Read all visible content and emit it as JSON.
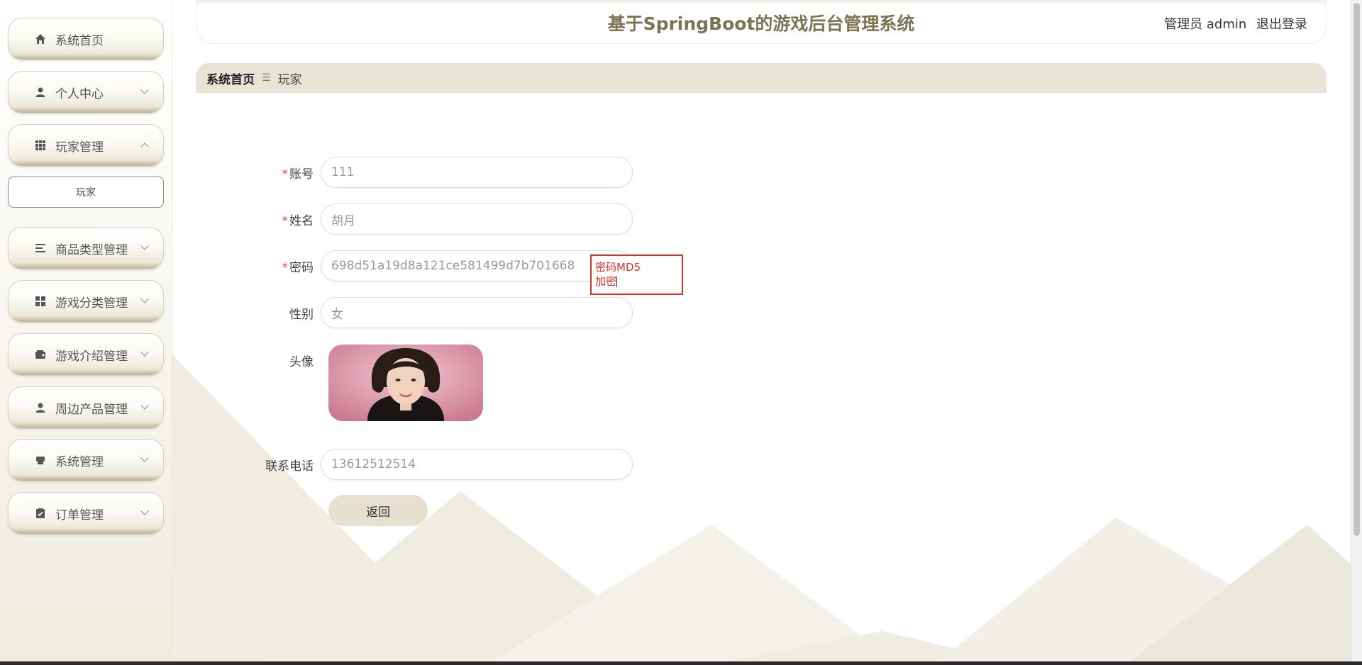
{
  "app": {
    "title": "基于SpringBoot的游戏后台管理系统",
    "user_label": "管理员 admin",
    "logout": "退出登录"
  },
  "breadcrumb": {
    "home": "系统首页",
    "separator": "☰",
    "current": "玩家"
  },
  "sidebar": {
    "items": [
      {
        "label": "系统首页",
        "icon": "home-icon"
      },
      {
        "label": "个人中心",
        "icon": "user-icon"
      },
      {
        "label": "玩家管理",
        "icon": "grid-icon",
        "expanded": true
      },
      {
        "label": "商品类型管理",
        "icon": "list-icon"
      },
      {
        "label": "游戏分类管理",
        "icon": "apps-icon"
      },
      {
        "label": "游戏介绍管理",
        "icon": "wallet-icon"
      },
      {
        "label": "周边产品管理",
        "icon": "user-icon"
      },
      {
        "label": "系统管理",
        "icon": "printer-icon"
      },
      {
        "label": "订单管理",
        "icon": "clipboard-icon"
      }
    ],
    "subitems": [
      {
        "label": "玩家"
      }
    ]
  },
  "form": {
    "account": {
      "label": "账号",
      "value": "111",
      "required": true
    },
    "name": {
      "label": "姓名",
      "value": "胡月",
      "required": true
    },
    "password": {
      "label": "密码",
      "value": "698d51a19d8a121ce581499d7b701668",
      "required": true
    },
    "gender": {
      "label": "性别",
      "value": "女",
      "required": false
    },
    "avatar": {
      "label": "头像"
    },
    "phone": {
      "label": "联系电话",
      "value": "13612512514",
      "required": false
    },
    "back_label": "返回",
    "required_mark": "*"
  },
  "annotation": {
    "line1": "密码MD5",
    "line2": "加密"
  },
  "colors": {
    "accent": "#7d7352",
    "breadcrumb_bg": "#e8e4d5",
    "required": "#e04a4a",
    "annotation": "#d9322b"
  }
}
